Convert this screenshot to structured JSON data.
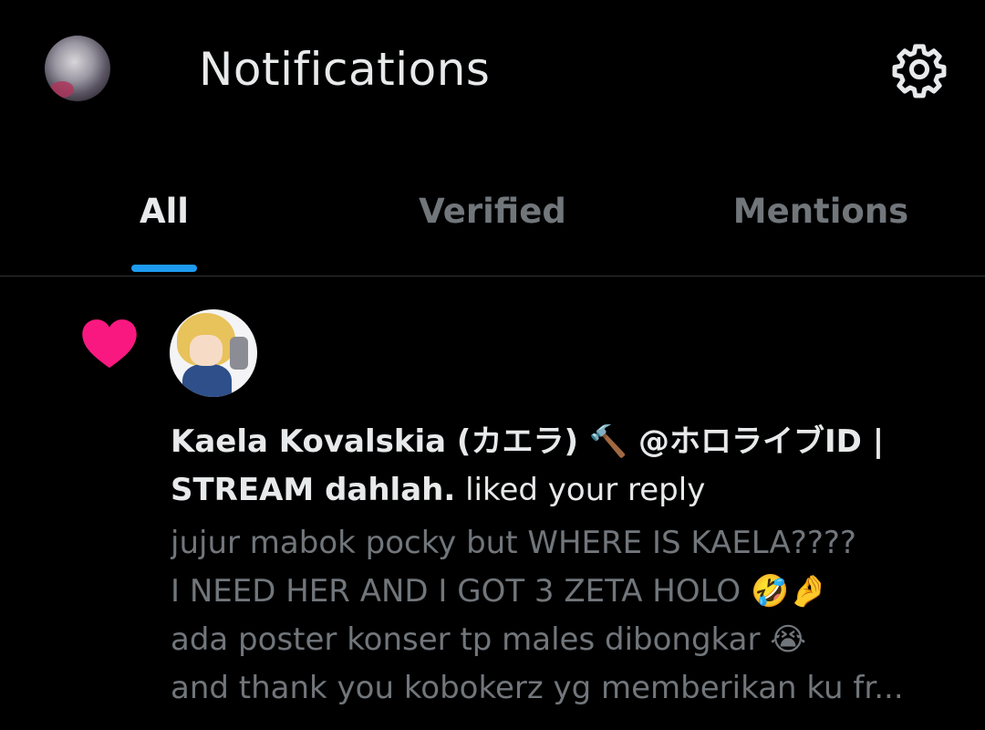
{
  "header": {
    "title": "Notifications"
  },
  "tabs": [
    {
      "label": "All",
      "active": true
    },
    {
      "label": "Verified",
      "active": false
    },
    {
      "label": "Mentions",
      "active": false
    }
  ],
  "notification": {
    "type": "like",
    "user_name": "Kaela Kovalskia (カエラ) 🔨 @ホロライブID | STREAM dahlah.",
    "action": " liked your reply",
    "preview_lines": [
      "jujur mabok pocky but WHERE IS KAELA????",
      "I NEED HER AND I GOT 3 ZETA HOLO 🤣🤌",
      "ada poster konser tp males dibongkar 😭",
      "and thank you kobokerz yg memberikan ku fr..."
    ]
  },
  "colors": {
    "background": "#000000",
    "text_primary": "#e7e9ea",
    "text_secondary": "#71767b",
    "accent": "#1d9bf0",
    "like": "#f91880",
    "divider": "#2f3336"
  },
  "icons": {
    "settings": "gear-icon",
    "like": "heart-icon"
  }
}
